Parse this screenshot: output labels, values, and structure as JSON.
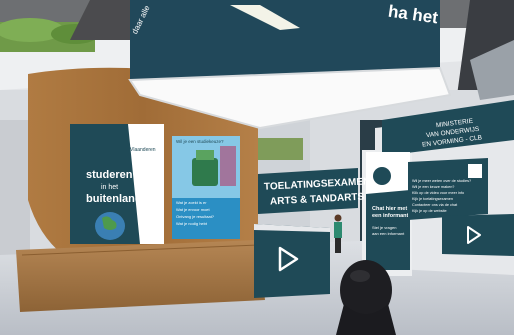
{
  "scene": {
    "colors": {
      "teal": "#1f4a57",
      "wood": "#a8743e",
      "floor": "#c7ccd3",
      "ceiling_light": "#ffffff"
    }
  },
  "hanging_banner": {
    "text_fragment": "ha het",
    "side_text": "daar alle"
  },
  "poster_studeren": {
    "org": "Vlaanderen",
    "title_lines": [
      "studeren",
      "in het",
      "buitenland"
    ]
  },
  "poster_info": {
    "header": "Wil je een studiekeuze?",
    "bullets": [
      "Wat je zoekt is er",
      "Wat je ervoor moet",
      "Ontvang je resultaat?",
      "Wat je nodig hebt"
    ]
  },
  "toelatingsexamen_sign": {
    "line1": "TOELATINGSEXAMEN",
    "line2": "ARTS & TANDARTS"
  },
  "ministerie_sign": {
    "line1": "MINISTERIE",
    "line2": "VAN ONDERWIJS",
    "line3": "EN VORMING - CLB"
  },
  "chat_banner": {
    "title_lines": [
      "Chat hier met",
      "een informant"
    ],
    "sub_lines": [
      "Stel je vragen",
      "aan een informant"
    ]
  },
  "info_board": {
    "lines": [
      "Wil je meer weten over de studies?",
      "Wil je een keuze maken?",
      "Klik op de video voor meer info",
      "Kijk je toelatingsexamen",
      "Contacteer ons via de chat",
      "Kijk je op de website"
    ]
  },
  "icons": [
    "play-icon",
    "play-icon",
    "play-icon",
    "logo-icon",
    "logo-icon"
  ]
}
